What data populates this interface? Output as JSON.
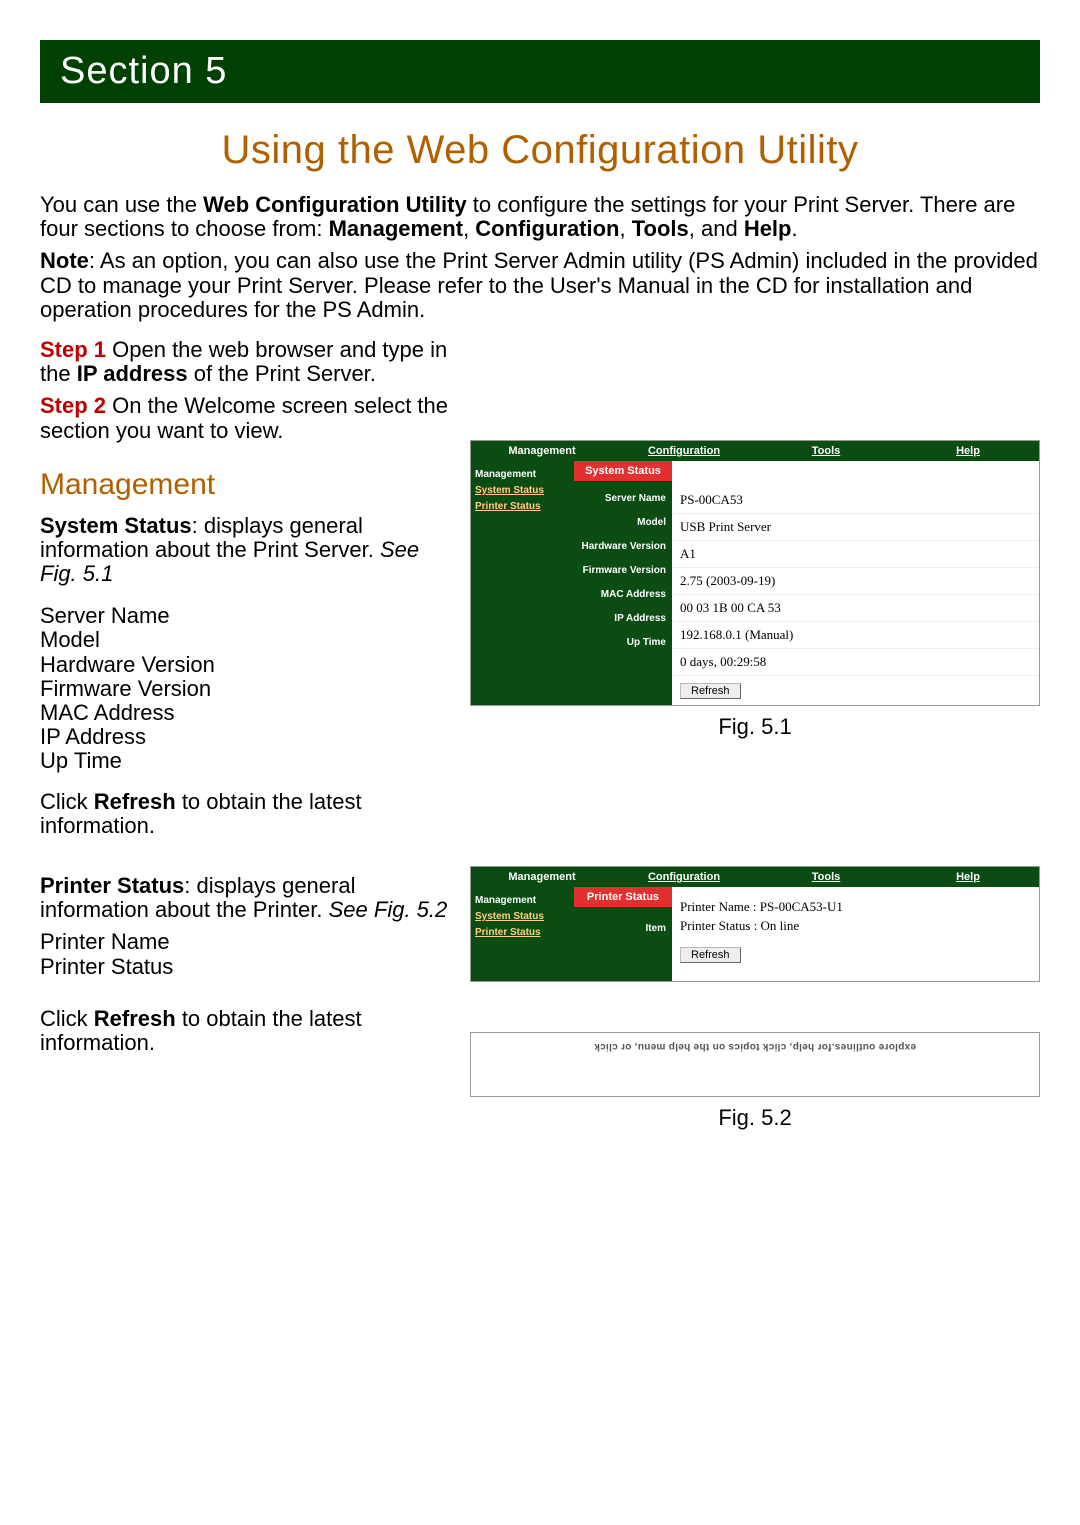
{
  "banner": "Section 5",
  "title": "Using the Web Configuration Utility",
  "intro_parts": {
    "p1_a": "You can use the ",
    "p1_b": "Web Configuration Utility",
    "p1_c": " to configure the settings for your Print Server. There are four sections to choose from: ",
    "p1_d": "Management",
    "p1_e": ", ",
    "p1_f": "Configuration",
    "p1_g": ", ",
    "p1_h": "Tools",
    "p1_i": ", and ",
    "p1_j": "Help",
    "p1_k": "."
  },
  "note": {
    "a": "Note",
    "b": ": As an option, you can also use the Print Server Admin utility (PS Admin) included in the provided CD to manage your Print Server.  Please refer to the User's Manual in the CD for installation and operation procedures for the PS Admin."
  },
  "steps": {
    "s1_label": "Step 1",
    "s1_a": " Open the web browser and type in the ",
    "s1_b": "IP address",
    "s1_c": " of the Print Server.",
    "s2_label": "Step 2",
    "s2_text": " On the Welcome screen select the section you want to view."
  },
  "mgmt_heading": "Management",
  "system_status": {
    "a": "System Status",
    "b": ": displays general information about the Print Server. ",
    "c": "See Fig. 5.1"
  },
  "fields1": [
    "Server Name",
    "Model",
    "Hardware Version",
    "Firmware Version",
    "MAC Address",
    "IP Address",
    "Up Time"
  ],
  "refresh_text": {
    "a": "Click ",
    "b": "Refresh",
    "c": " to obtain the latest information."
  },
  "printer_status": {
    "a": "Printer Status",
    "b": ": displays general information about the Printer. ",
    "c": "See Fig. 5.2"
  },
  "fields2": [
    "Printer Name",
    "Printer Status"
  ],
  "fig51_caption": "Fig. 5.1",
  "fig52_caption": "Fig. 5.2",
  "panel": {
    "tabs": [
      "Management",
      "Configuration",
      "Tools",
      "Help"
    ],
    "side": {
      "head": "Management",
      "sub1": "System Status",
      "sub2": "Printer Status"
    },
    "status_title_sys": "System Status",
    "status_title_prn": "Printer Status",
    "rows": [
      {
        "label": "Server Name",
        "value": "PS-00CA53"
      },
      {
        "label": "Model",
        "value": "USB Print Server"
      },
      {
        "label": "Hardware Version",
        "value": "A1"
      },
      {
        "label": "Firmware Version",
        "value": "2.75 (2003-09-19)"
      },
      {
        "label": "MAC Address",
        "value": "00 03 1B 00 CA 53"
      },
      {
        "label": "IP Address",
        "value": "192.168.0.1 (Manual)"
      },
      {
        "label": "Up Time",
        "value": "0 days, 00:29:58"
      }
    ],
    "refresh_btn": "Refresh",
    "printer_item_label": "Item",
    "printer_name_line": "Printer Name : PS-00CA53-U1",
    "printer_status_line": "Printer Status : On line"
  },
  "blur_line": "explore outlines.for help, click topics on the help menu, or click"
}
